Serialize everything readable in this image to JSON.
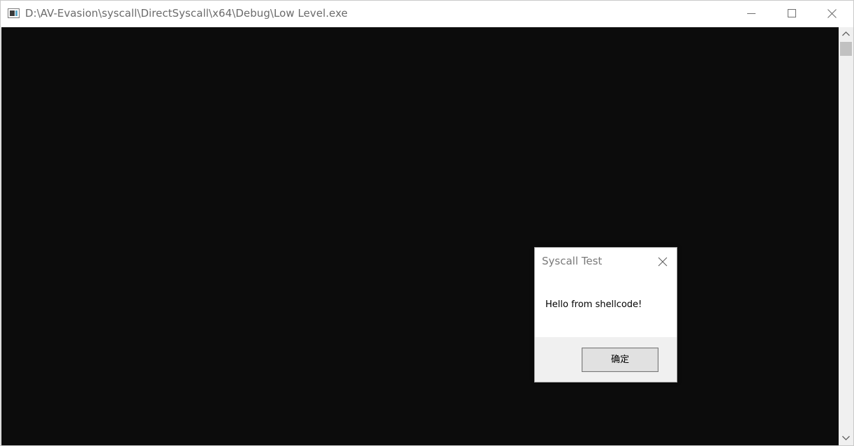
{
  "window": {
    "title": "D:\\AV-Evasion\\syscall\\DirectSyscall\\x64\\Debug\\Low Level.exe",
    "icon": "console-app-icon",
    "controls": [
      "minimize-icon",
      "maximize-icon",
      "close-icon"
    ]
  },
  "console": {
    "background": "#0c0c0c",
    "scrollbar": {
      "up": "arrow-up-icon",
      "down": "arrow-down-icon"
    }
  },
  "dialog": {
    "title": "Syscall Test",
    "message": "Hello from shellcode!",
    "ok_label": "确定",
    "close_icon": "close-icon"
  }
}
